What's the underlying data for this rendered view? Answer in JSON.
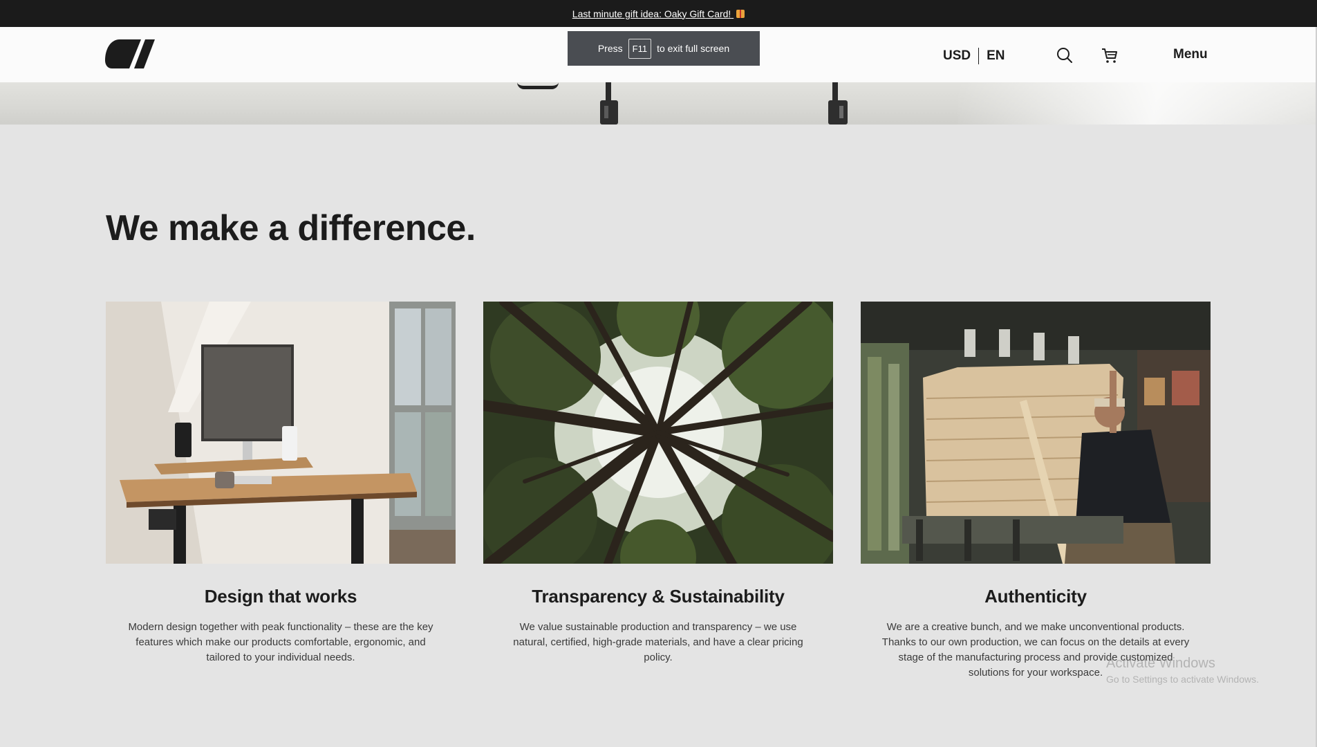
{
  "announcement": {
    "text": "Last minute gift idea: Oaky Gift Card!"
  },
  "fullscreen_notice": {
    "prefix": "Press",
    "key": "F11",
    "suffix": "to exit full screen"
  },
  "header": {
    "currency": "USD",
    "language": "EN",
    "menu_label": "Menu",
    "icons": [
      "logo",
      "search-icon",
      "cart-icon"
    ]
  },
  "section": {
    "title": "We make a difference.",
    "cards": [
      {
        "title": "Design that works",
        "text": "Modern design together with peak functionality – these are the key features which make our products comfortable, ergonomic, and tailored to your individual needs."
      },
      {
        "title": "Transparency & Sustainability",
        "text": "We value sustainable production and transparency – we use natural, certified, high-grade materials, and have a clear pricing policy."
      },
      {
        "title": "Authenticity",
        "text": "We are a creative bunch, and we make unconventional products. Thanks to our own production, we can focus on the details at every stage of the manufacturing process and provide customized solutions for your workspace."
      }
    ]
  },
  "watermark": {
    "line1": "Activate Windows",
    "line2": "Go to Settings to activate Windows."
  },
  "colors": {
    "announcement_bg": "#1b1b1b",
    "header_bg": "#fbfbfb",
    "page_bg": "#e4e4e4",
    "text": "#1c1c1c"
  }
}
